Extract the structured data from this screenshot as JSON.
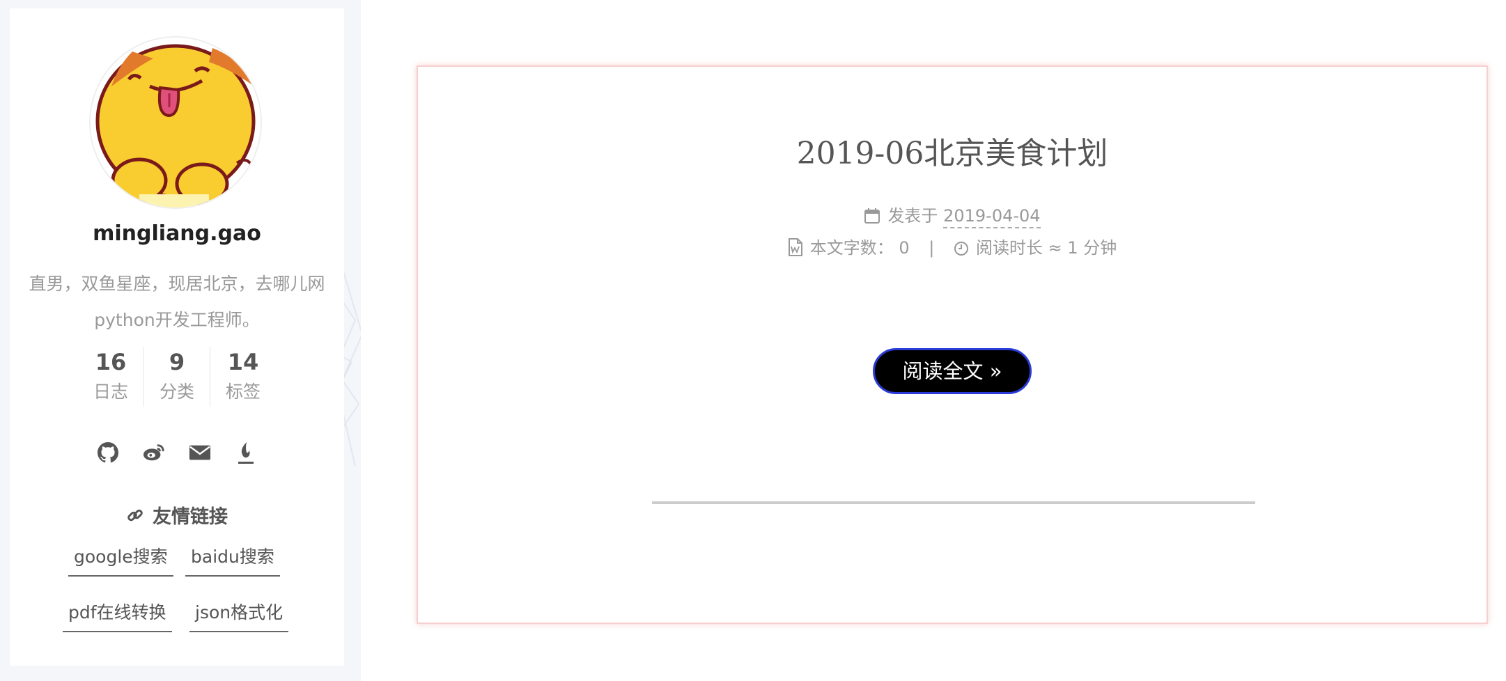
{
  "sidebar": {
    "author": "mingliang.gao",
    "description": "直男，双鱼星座，现居北京，去哪儿网python开发工程师。",
    "stats": [
      {
        "count": "16",
        "label": "日志"
      },
      {
        "count": "9",
        "label": "分类"
      },
      {
        "count": "14",
        "label": "标签"
      }
    ],
    "social_icons": [
      "github-icon",
      "weibo-icon",
      "email-icon",
      "csdn-icon"
    ],
    "links_title": "友情链接",
    "links": [
      "google搜索",
      "baidu搜索",
      "pdf在线转换",
      "json格式化"
    ]
  },
  "post": {
    "title": "2019-06北京美食计划",
    "posted_label": "发表于",
    "date": "2019-04-04",
    "wordcount_label": "本文字数：",
    "wordcount": "0",
    "separator": "|",
    "readtime_label": "阅读时长 ≈",
    "readtime": "1 分钟",
    "read_more": "阅读全文 »"
  }
}
